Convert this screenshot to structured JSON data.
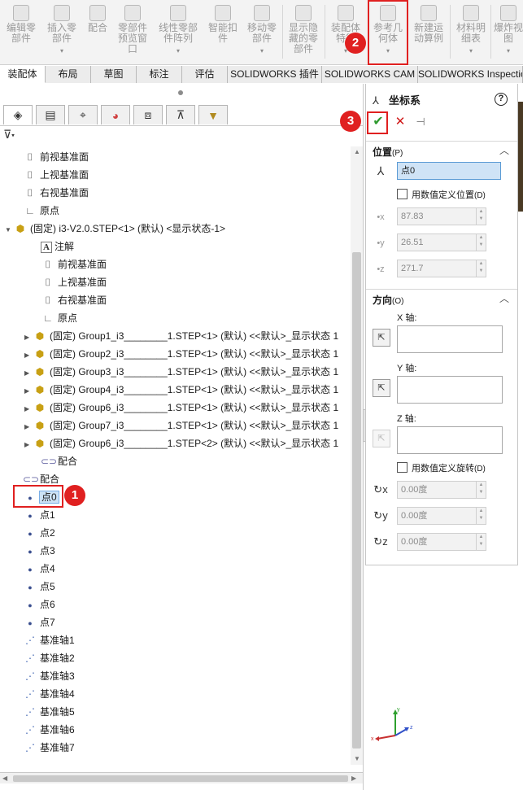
{
  "ribbon": {
    "buttons": [
      {
        "label": "编辑零\n部件",
        "arrow": ""
      },
      {
        "label": "插入零\n部件",
        "arrow": "▾"
      },
      {
        "label": "配合",
        "arrow": ""
      },
      {
        "label": "零部件\n预览窗\n口",
        "arrow": ""
      },
      {
        "label": "线性零部\n件阵列",
        "arrow": "▾"
      },
      {
        "label": "智能扣\n件",
        "arrow": ""
      },
      {
        "label": "移动零\n部件",
        "arrow": "▾"
      },
      {
        "label": "显示隐\n藏的零\n部件",
        "arrow": ""
      },
      {
        "label": "装配体\n特征",
        "arrow": "▾"
      },
      {
        "label": "参考几\n何体",
        "arrow": "▾"
      },
      {
        "label": "新建运\n动算例",
        "arrow": ""
      },
      {
        "label": "材料明\n细表",
        "arrow": "▾"
      },
      {
        "label": "爆炸视\n图",
        "arrow": "▾"
      }
    ]
  },
  "tabs": [
    "装配体",
    "布局",
    "草图",
    "标注",
    "评估",
    "SOLIDWORKS 插件",
    "SOLIDWORKS CAM",
    "SOLIDWORKS Inspection"
  ],
  "tree": {
    "items": [
      {
        "label": "前视基准面",
        "icon": "plane-icon"
      },
      {
        "label": "上视基准面",
        "icon": "plane-icon"
      },
      {
        "label": "右视基准面",
        "icon": "plane-icon"
      },
      {
        "label": "原点",
        "icon": "origin-icon"
      },
      {
        "label": "(固定) i3-V2.0.STEP<1> (默认) <显示状态-1>",
        "icon": "assembly-icon"
      },
      {
        "label": "注解",
        "icon": "annotation-icon"
      },
      {
        "label": "前视基准面",
        "icon": "plane-icon"
      },
      {
        "label": "上视基准面",
        "icon": "plane-icon"
      },
      {
        "label": "右视基准面",
        "icon": "plane-icon"
      },
      {
        "label": "原点",
        "icon": "origin-icon"
      },
      {
        "label": "(固定) Group1_i3________1.STEP<1> (默认) <<默认>_显示状态 1",
        "icon": "part-icon"
      },
      {
        "label": "(固定) Group2_i3________1.STEP<1> (默认) <<默认>_显示状态 1",
        "icon": "part-icon"
      },
      {
        "label": "(固定) Group3_i3________1.STEP<1> (默认) <<默认>_显示状态 1",
        "icon": "part-icon"
      },
      {
        "label": "(固定) Group4_i3________1.STEP<1> (默认) <<默认>_显示状态 1",
        "icon": "part-icon"
      },
      {
        "label": "(固定) Group6_i3________1.STEP<1> (默认) <<默认>_显示状态 1",
        "icon": "part-icon"
      },
      {
        "label": "(固定) Group7_i3________1.STEP<1> (默认) <<默认>_显示状态 1",
        "icon": "part-icon"
      },
      {
        "label": "(固定) Group6_i3________1.STEP<2> (默认) <<默认>_显示状态 1",
        "icon": "part-icon"
      },
      {
        "label": "配合",
        "icon": "mate-icon"
      },
      {
        "label": "配合",
        "icon": "mate-icon"
      },
      {
        "label": "点0",
        "icon": "point-icon"
      },
      {
        "label": "点1",
        "icon": "point-icon"
      },
      {
        "label": "点2",
        "icon": "point-icon"
      },
      {
        "label": "点3",
        "icon": "point-icon"
      },
      {
        "label": "点4",
        "icon": "point-icon"
      },
      {
        "label": "点5",
        "icon": "point-icon"
      },
      {
        "label": "点6",
        "icon": "point-icon"
      },
      {
        "label": "点7",
        "icon": "point-icon"
      },
      {
        "label": "基准轴1",
        "icon": "axis-icon"
      },
      {
        "label": "基准轴2",
        "icon": "axis-icon"
      },
      {
        "label": "基准轴3",
        "icon": "axis-icon"
      },
      {
        "label": "基准轴4",
        "icon": "axis-icon"
      },
      {
        "label": "基准轴5",
        "icon": "axis-icon"
      },
      {
        "label": "基准轴6",
        "icon": "axis-icon"
      },
      {
        "label": "基准轴7",
        "icon": "axis-icon"
      }
    ]
  },
  "property_manager": {
    "title": "坐标系",
    "position": {
      "header": "位置",
      "header_key": "(P)",
      "point_value": "点0",
      "numeric_checkbox_label": "用数值定义位置",
      "numeric_checkbox_key": "(D)",
      "x": "87.83",
      "y": "26.51",
      "z": "271.7"
    },
    "orientation": {
      "header": "方向",
      "header_key": "(O)",
      "x_axis_label": "X 轴:",
      "y_axis_label": "Y 轴:",
      "z_axis_label": "Z 轴:",
      "rotation_checkbox_label": "用数值定义旋转",
      "rotation_checkbox_key": "(D)",
      "rx": "0.00度",
      "ry": "0.00度",
      "rz": "0.00度"
    }
  },
  "callouts": {
    "one": "1",
    "two": "2",
    "three": "3"
  },
  "colors": {
    "accent_red": "#e02020",
    "ok_green": "#2e9a2e",
    "selection_blue": "#cce2f6"
  }
}
